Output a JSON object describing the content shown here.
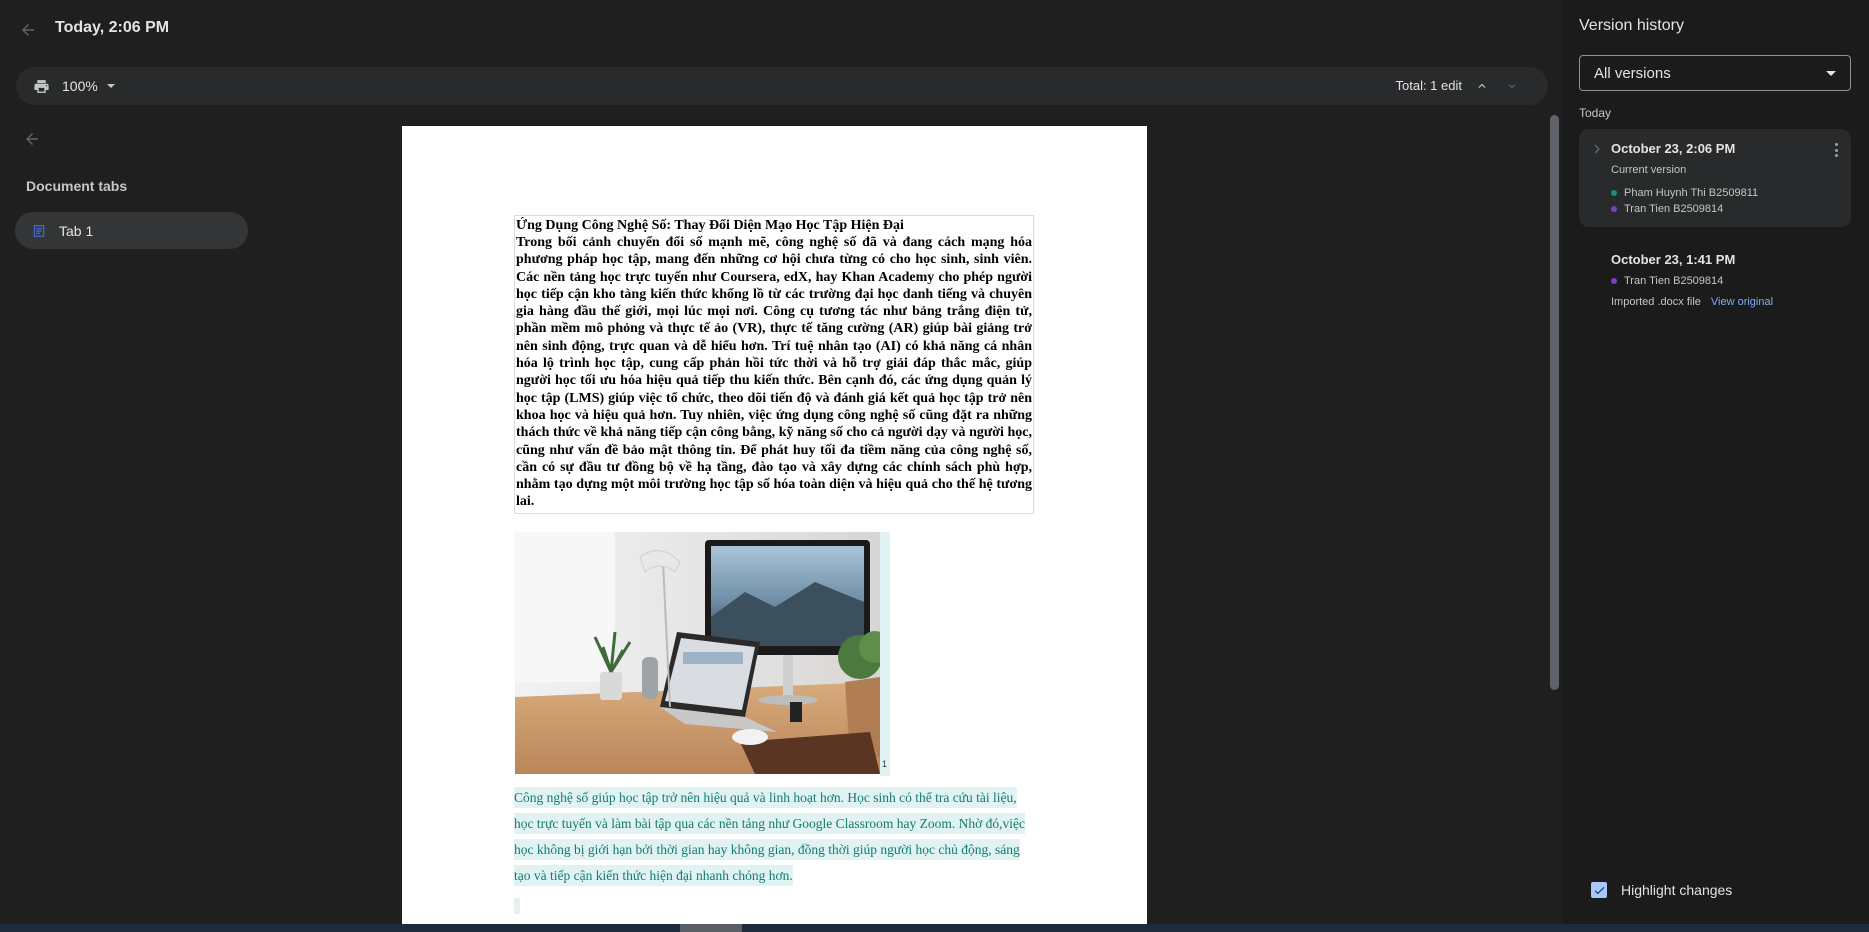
{
  "header": {
    "title": "Today, 2:06 PM"
  },
  "toolbar": {
    "zoom": "100%",
    "total_edits": "Total: 1 edit"
  },
  "left_panel": {
    "title": "Document tabs",
    "tabs": [
      {
        "label": "Tab 1"
      }
    ]
  },
  "document": {
    "heading": "Ứng Dụng Công Nghệ Số: Thay Đổi Diện Mạo Học Tập Hiện Đại",
    "body": "Trong bối cảnh chuyển đổi số mạnh mẽ, công nghệ số đã và đang cách mạng hóa phương pháp học tập, mang đến những cơ hội chưa từng có cho học sinh, sinh viên. Các nền tảng học trực tuyến như Coursera, edX, hay Khan Academy cho phép người học tiếp cận kho tàng kiến thức khổng lồ từ các trường đại học danh tiếng và chuyên gia hàng đầu thế giới, mọi lúc mọi nơi. Công cụ tương tác như bảng trắng điện tử, phần mềm mô phỏng và thực tế ảo (VR), thực tế tăng cường (AR) giúp bài giảng trở nên sinh động, trực quan và dễ hiểu hơn. Trí tuệ nhân tạo (AI) có khả năng cá nhân hóa lộ trình học tập, cung cấp phản hồi tức thời và hỗ trợ giải đáp thắc mắc, giúp người học tối ưu hóa hiệu quả tiếp thu kiến thức. Bên cạnh đó, các ứng dụng quản lý học tập (LMS) giúp việc tổ chức, theo dõi tiến độ và đánh giá kết quả học tập trở nên khoa học và hiệu quả hơn. Tuy nhiên, việc ứng dụng công nghệ số cũng đặt ra những thách thức về khả năng tiếp cận công bằng, kỹ năng số cho cả người dạy và người học, cũng như vấn đề bảo mật thông tin. Để phát huy tối đa tiềm năng của công nghệ số, cần có sự đầu tư đồng bộ về hạ tầng, đào tạo và xây dựng các chính sách phù hợp, nhằm tạo dựng một môi trường học tập số hóa toàn diện và hiệu quả cho thế hệ tương lai.",
    "image_marker": "1",
    "added_paragraph": "Công nghệ số giúp học tập trở nên hiệu quả và linh hoạt hơn. Học sinh có thể tra cứu tài liệu, học trực tuyến và làm bài tập qua các nền tảng như Google Classroom hay Zoom. Nhờ đó,việc học không bị giới hạn bởi thời gian hay không gian, đồng thời giúp người học chủ động, sáng tạo và tiếp cận kiến thức hiện đại nhanh chóng hơn."
  },
  "version_history": {
    "title": "Version history",
    "filter": "All versions",
    "group_label": "Today",
    "versions": [
      {
        "date": "October 23, 2:06 PM",
        "subtitle": "Current version",
        "authors": [
          {
            "name": "Pham Huynh Thi B2509811",
            "color": "#1e8e7e"
          },
          {
            "name": "Tran Tien B2509814",
            "color": "#7b3fc7"
          }
        ]
      },
      {
        "date": "October 23, 1:41 PM",
        "authors": [
          {
            "name": "Tran Tien B2509814",
            "color": "#7b3fc7"
          }
        ],
        "note": "Imported .docx file",
        "link": "View original"
      }
    ],
    "highlight_label": "Highlight changes",
    "highlight_checked": true
  },
  "colors": {
    "background": "#1f1f1f",
    "panel": "#1b1b1b",
    "added_text": "#137c6f",
    "added_highlight": "#e0f2f1",
    "link": "#7cacf8",
    "checkbox": "#a8c7fa"
  },
  "icons": [
    "arrow-back-icon",
    "print-icon",
    "dropdown-caret-icon",
    "chevron-up-icon",
    "chevron-down-icon",
    "document-tab-icon",
    "chevron-right-icon",
    "more-vert-icon",
    "check-icon"
  ]
}
